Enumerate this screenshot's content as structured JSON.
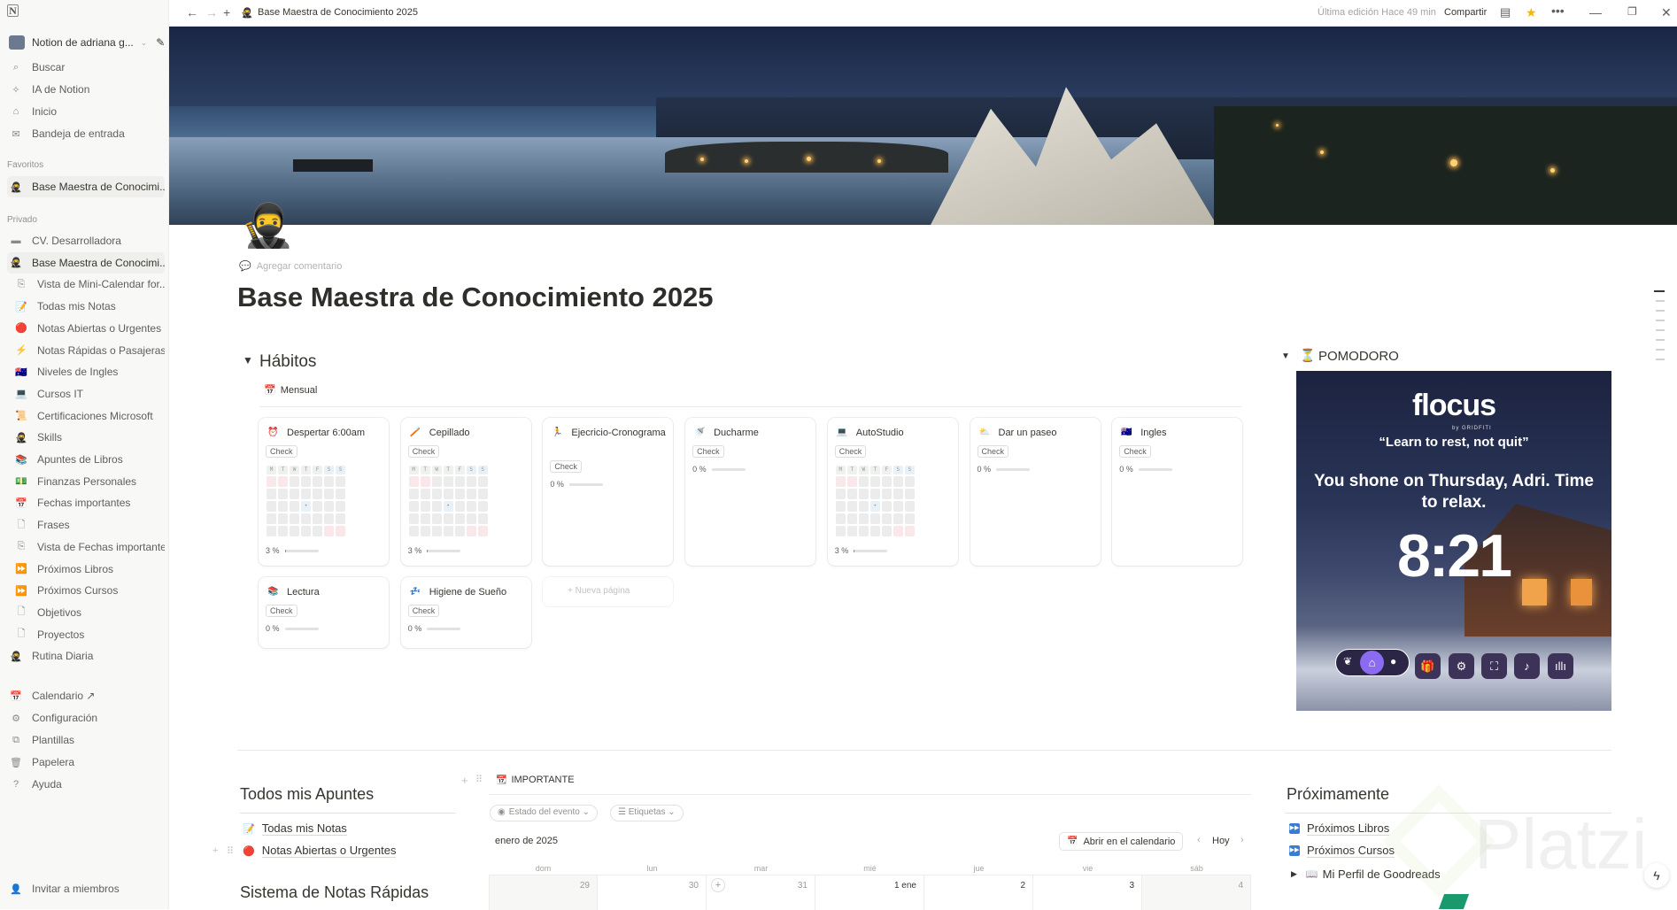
{
  "topbar": {
    "breadcrumb": "Base Maestra de Conocimiento 2025",
    "last_edit": "Última edición Hace 49 min",
    "share": "Compartir"
  },
  "sidebar": {
    "workspace": "Notion de adriana g...",
    "nav": [
      {
        "label": "Buscar",
        "icon": "search-icon"
      },
      {
        "label": "IA de Notion",
        "icon": "ai-icon"
      },
      {
        "label": "Inicio",
        "icon": "home-icon"
      },
      {
        "label": "Bandeja de entrada",
        "icon": "inbox-icon"
      }
    ],
    "favorites_label": "Favoritos",
    "favorites": [
      {
        "label": "Base Maestra de Conocimi...",
        "icon": "ninja-icon"
      }
    ],
    "private_label": "Privado",
    "private": [
      {
        "label": "CV. Desarrolladora",
        "icon": "card-icon",
        "child": false
      },
      {
        "label": "Base Maestra de Conocimi...",
        "icon": "ninja-icon",
        "child": false,
        "selected": true
      },
      {
        "label": "Vista de Mini-Calendar for...",
        "icon": "linked-page-icon",
        "child": true
      },
      {
        "label": "Todas mis Notas",
        "icon": "memo-icon",
        "child": true
      },
      {
        "label": "Notas Abiertas o Urgentes",
        "icon": "red-circle-icon",
        "child": true
      },
      {
        "label": "Notas Rápidas o Pasajeras",
        "icon": "lightning-icon",
        "child": true
      },
      {
        "label": "Niveles de Ingles",
        "icon": "flag-icon",
        "child": true
      },
      {
        "label": "Cursos IT",
        "icon": "laptop-icon",
        "child": true
      },
      {
        "label": "Certificaciones Microsoft",
        "icon": "scroll-icon",
        "child": true
      },
      {
        "label": "Skills",
        "icon": "ninja-icon",
        "child": true
      },
      {
        "label": "Apuntes de Libros",
        "icon": "books-icon",
        "child": true
      },
      {
        "label": "Finanzas Personales",
        "icon": "money-icon",
        "child": true
      },
      {
        "label": "Fechas importantes",
        "icon": "calendar-icon",
        "child": true
      },
      {
        "label": "Frases",
        "icon": "page-icon",
        "child": true
      },
      {
        "label": "Vista de Fechas importantes",
        "icon": "linked-page-icon",
        "child": true
      },
      {
        "label": "Próximos Libros",
        "icon": "fast-forward-icon",
        "child": true
      },
      {
        "label": "Próximos Cursos",
        "icon": "fast-forward-icon",
        "child": true
      },
      {
        "label": "Objetivos",
        "icon": "page-icon",
        "child": true
      },
      {
        "label": "Proyectos",
        "icon": "page-icon",
        "child": true
      },
      {
        "label": "Rutina Diaria",
        "icon": "ninja-icon",
        "child": false
      }
    ],
    "bottom": [
      {
        "label": "Calendario ↗",
        "icon": "calendar-icon"
      },
      {
        "label": "Configuración",
        "icon": "gear-icon"
      },
      {
        "label": "Plantillas",
        "icon": "templates-icon"
      },
      {
        "label": "Papelera",
        "icon": "trash-icon"
      },
      {
        "label": "Ayuda",
        "icon": "help-icon"
      }
    ],
    "invite": "Invitar a miembros"
  },
  "page": {
    "add_comment": "Agregar comentario",
    "title": "Base Maestra de Conocimiento 2025",
    "habits": {
      "heading": "Hábitos",
      "view": "Mensual",
      "check_label": "Check",
      "new_page": "+ Nueva página",
      "weekdays": [
        "M",
        "T",
        "W",
        "T",
        "F",
        "S",
        "S"
      ],
      "cards": [
        {
          "title": "Despertar 6:00am",
          "icon": "⏰",
          "percent": 3,
          "grid": true
        },
        {
          "title": "Cepillado",
          "icon": "🪥",
          "percent": 3,
          "grid": true
        },
        {
          "title": "Ejecricio-Cronograma",
          "icon": "🏃",
          "percent": 0,
          "grid": false
        },
        {
          "title": "Ducharme",
          "icon": "🚿",
          "percent": 0,
          "grid": false
        },
        {
          "title": "AutoStudio",
          "icon": "💻",
          "percent": 3,
          "grid": true
        },
        {
          "title": "Dar un paseo",
          "icon": "⛅",
          "percent": 0,
          "grid": false
        },
        {
          "title": "Ingles",
          "icon": "🇦🇺",
          "percent": 0,
          "grid": false
        },
        {
          "title": "Lectura",
          "icon": "📚",
          "percent": 0,
          "grid": false
        },
        {
          "title": "Higiene de Sueño",
          "icon": "💤",
          "percent": 0,
          "grid": false
        }
      ]
    },
    "pomodoro": {
      "heading": "POMODORO",
      "brand": "flocus",
      "brand_sub": "by GRIDFITI",
      "quote": "“Learn to rest, not quit”",
      "message": "You shone on Thursday, Adri. Time to relax.",
      "time": "8:21",
      "accent": "#8b6cf0"
    },
    "apuntes": {
      "heading": "Todos mis Apuntes",
      "items": [
        {
          "label": "Todas mis Notas",
          "icon": "📝"
        },
        {
          "label": "Notas Abiertas o Urgentes",
          "icon": "🔴"
        }
      ],
      "heading2": "Sistema de Notas Rápidas"
    },
    "calendar": {
      "title": "IMPORTANTE",
      "filters": [
        "Estado del evento ⌄",
        "☰ Etiquetas ⌄"
      ],
      "month": "enero de 2025",
      "open_button": "Abrir en el calendario",
      "today": "Hoy",
      "weekdays": [
        "dom",
        "lun",
        "mar",
        "mié",
        "jue",
        "vie",
        "sáb"
      ],
      "days": [
        "29",
        "30",
        "31",
        "1 ene",
        "2",
        "3",
        "4"
      ]
    },
    "proximamente": {
      "heading": "Próximamente",
      "items": [
        {
          "label": "Próximos Libros"
        },
        {
          "label": "Próximos Cursos"
        }
      ],
      "toggle": "Mi Perfil de Goodreads"
    }
  },
  "watermark": "Platzi"
}
